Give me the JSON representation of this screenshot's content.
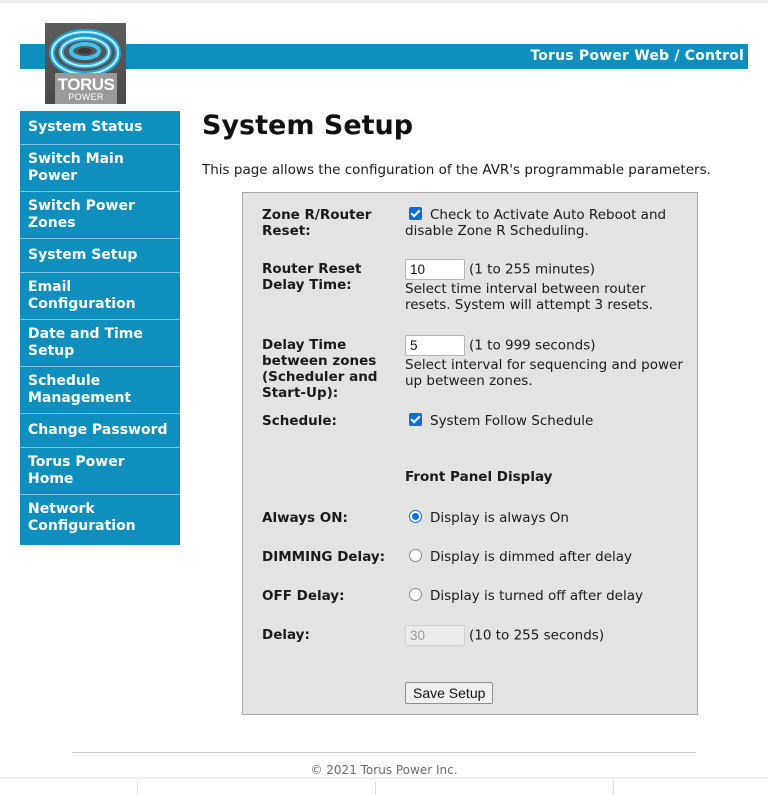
{
  "header": {
    "title": "Torus Power Web / Control",
    "brand_color": "#0e8fbd",
    "logo": {
      "main": "TORUS",
      "sub": "POWER"
    }
  },
  "sidebar": {
    "items": [
      {
        "label": "System Status"
      },
      {
        "label": "Switch Main Power"
      },
      {
        "label": "Switch Power Zones"
      },
      {
        "label": "System Setup"
      },
      {
        "label": "Email Configuration"
      },
      {
        "label": "Date and Time Setup"
      },
      {
        "label": "Schedule Management"
      },
      {
        "label": "Change Password"
      },
      {
        "label": "Torus Power Home"
      },
      {
        "label": "Network Configuration"
      }
    ]
  },
  "main": {
    "title": "System Setup",
    "description": "This page allows the configuration of the AVR's programmable parameters."
  },
  "form": {
    "zone_reset": {
      "label": "Zone R/Router Reset:",
      "checked": true,
      "text": "Check to Activate Auto Reboot and disable Zone R Scheduling."
    },
    "router_delay": {
      "label": "Router Reset Delay Time:",
      "value": "10",
      "range": "(1 to 255 minutes)",
      "help": "Select time interval between router resets. System will attempt 3 resets."
    },
    "zone_delay": {
      "label": "Delay Time between zones (Scheduler and Start-Up):",
      "value": "5",
      "range": "(1 to 999 seconds)",
      "help": "Select interval for sequencing and power up between zones."
    },
    "schedule": {
      "label": "Schedule:",
      "checked": true,
      "text": "System Follow Schedule"
    },
    "front_panel_title": "Front Panel Display",
    "display_options": [
      {
        "label": "Always ON:",
        "text": "Display is always On",
        "selected": true
      },
      {
        "label": "DIMMING Delay:",
        "text": "Display is dimmed after delay",
        "selected": false
      },
      {
        "label": "OFF Delay:",
        "text": "Display is turned off after delay",
        "selected": false
      }
    ],
    "delay": {
      "label": "Delay:",
      "value": "30",
      "range": "(10 to 255 seconds)",
      "disabled": true
    },
    "save_label": "Save Setup"
  },
  "footer": {
    "copyright": "© 2021 Torus Power Inc."
  }
}
